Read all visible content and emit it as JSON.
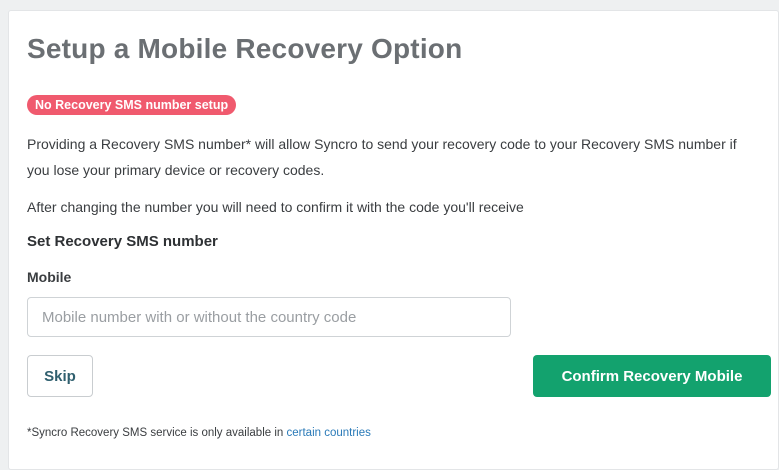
{
  "card": {
    "title": "Setup a Mobile Recovery Option",
    "status_badge": "No Recovery SMS number setup",
    "description": "Providing a Recovery SMS number* will allow Syncro to send your recovery code to your Recovery SMS number if you lose your primary device or recovery codes.",
    "change_note": "After changing the number you will need to confirm it with the code you'll receive",
    "section_title": "Set Recovery SMS number",
    "mobile_field": {
      "label": "Mobile",
      "value": "",
      "placeholder": "Mobile number with or without the country code"
    },
    "skip_label": "Skip",
    "confirm_label": "Confirm Recovery Mobile",
    "footnote_text": "*Syncro Recovery SMS service is only available in ",
    "footnote_link": "certain countries"
  },
  "colors": {
    "badge": "#f05a6e",
    "primary_button": "#13a26e",
    "link": "#2a7ab8",
    "title": "#6b6f73"
  }
}
